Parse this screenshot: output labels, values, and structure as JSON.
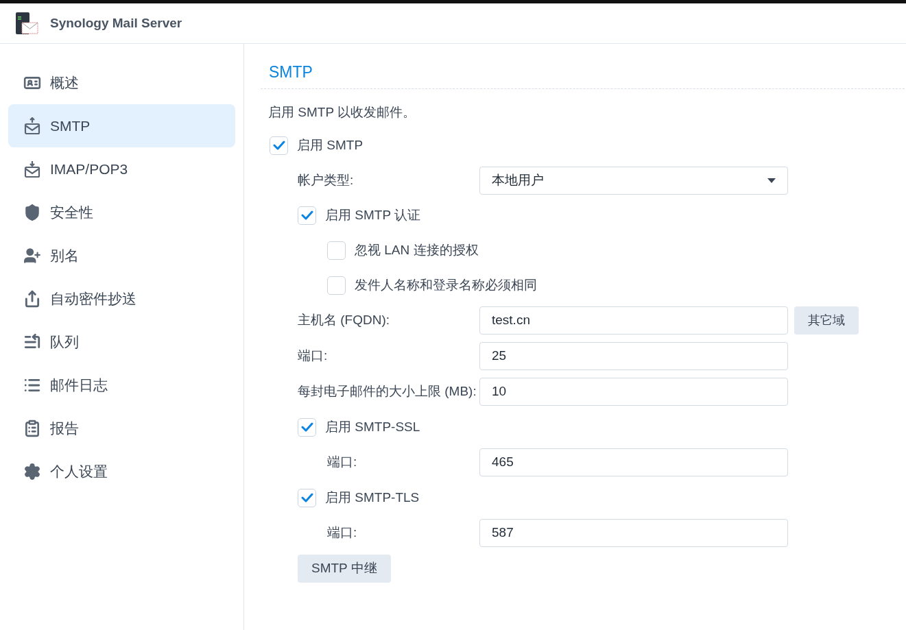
{
  "app": {
    "title": "Synology Mail Server"
  },
  "sidebar": {
    "items": [
      {
        "label": "概述",
        "selected": false
      },
      {
        "label": "SMTP",
        "selected": true
      },
      {
        "label": "IMAP/POP3",
        "selected": false
      },
      {
        "label": "安全性",
        "selected": false
      },
      {
        "label": "别名",
        "selected": false
      },
      {
        "label": "自动密件抄送",
        "selected": false
      },
      {
        "label": "队列",
        "selected": false
      },
      {
        "label": "邮件日志",
        "selected": false
      },
      {
        "label": "报告",
        "selected": false
      },
      {
        "label": "个人设置",
        "selected": false
      }
    ]
  },
  "content": {
    "title": "SMTP",
    "description": "启用 SMTP 以收发邮件。",
    "form": [
      {
        "kind": "checkbox",
        "label": "启用 SMTP",
        "checked": true,
        "children": [
          {
            "kind": "select",
            "label": "帐户类型:",
            "value": "本地用户"
          },
          {
            "kind": "checkbox",
            "label": "启用 SMTP 认证",
            "checked": true,
            "children": [
              {
                "kind": "checkbox",
                "label": "忽视 LAN 连接的授权",
                "checked": false
              },
              {
                "kind": "checkbox",
                "label": "发件人名称和登录名称必须相同",
                "checked": false
              }
            ]
          },
          {
            "kind": "field",
            "label": "主机名 (FQDN):",
            "value": "test.cn",
            "button": "其它域"
          },
          {
            "kind": "field",
            "label": "端口:",
            "value": "25"
          },
          {
            "kind": "field",
            "label": "每封电子邮件的大小上限 (MB):",
            "value": "10"
          },
          {
            "kind": "checkbox",
            "label": "启用 SMTP-SSL",
            "checked": true,
            "children": [
              {
                "kind": "field",
                "label": "端口:",
                "value": "465"
              }
            ]
          },
          {
            "kind": "checkbox",
            "label": "启用 SMTP-TLS",
            "checked": true,
            "children": [
              {
                "kind": "field",
                "label": "端口:",
                "value": "587"
              }
            ]
          },
          {
            "kind": "button",
            "label": "SMTP 中继"
          }
        ]
      }
    ]
  }
}
